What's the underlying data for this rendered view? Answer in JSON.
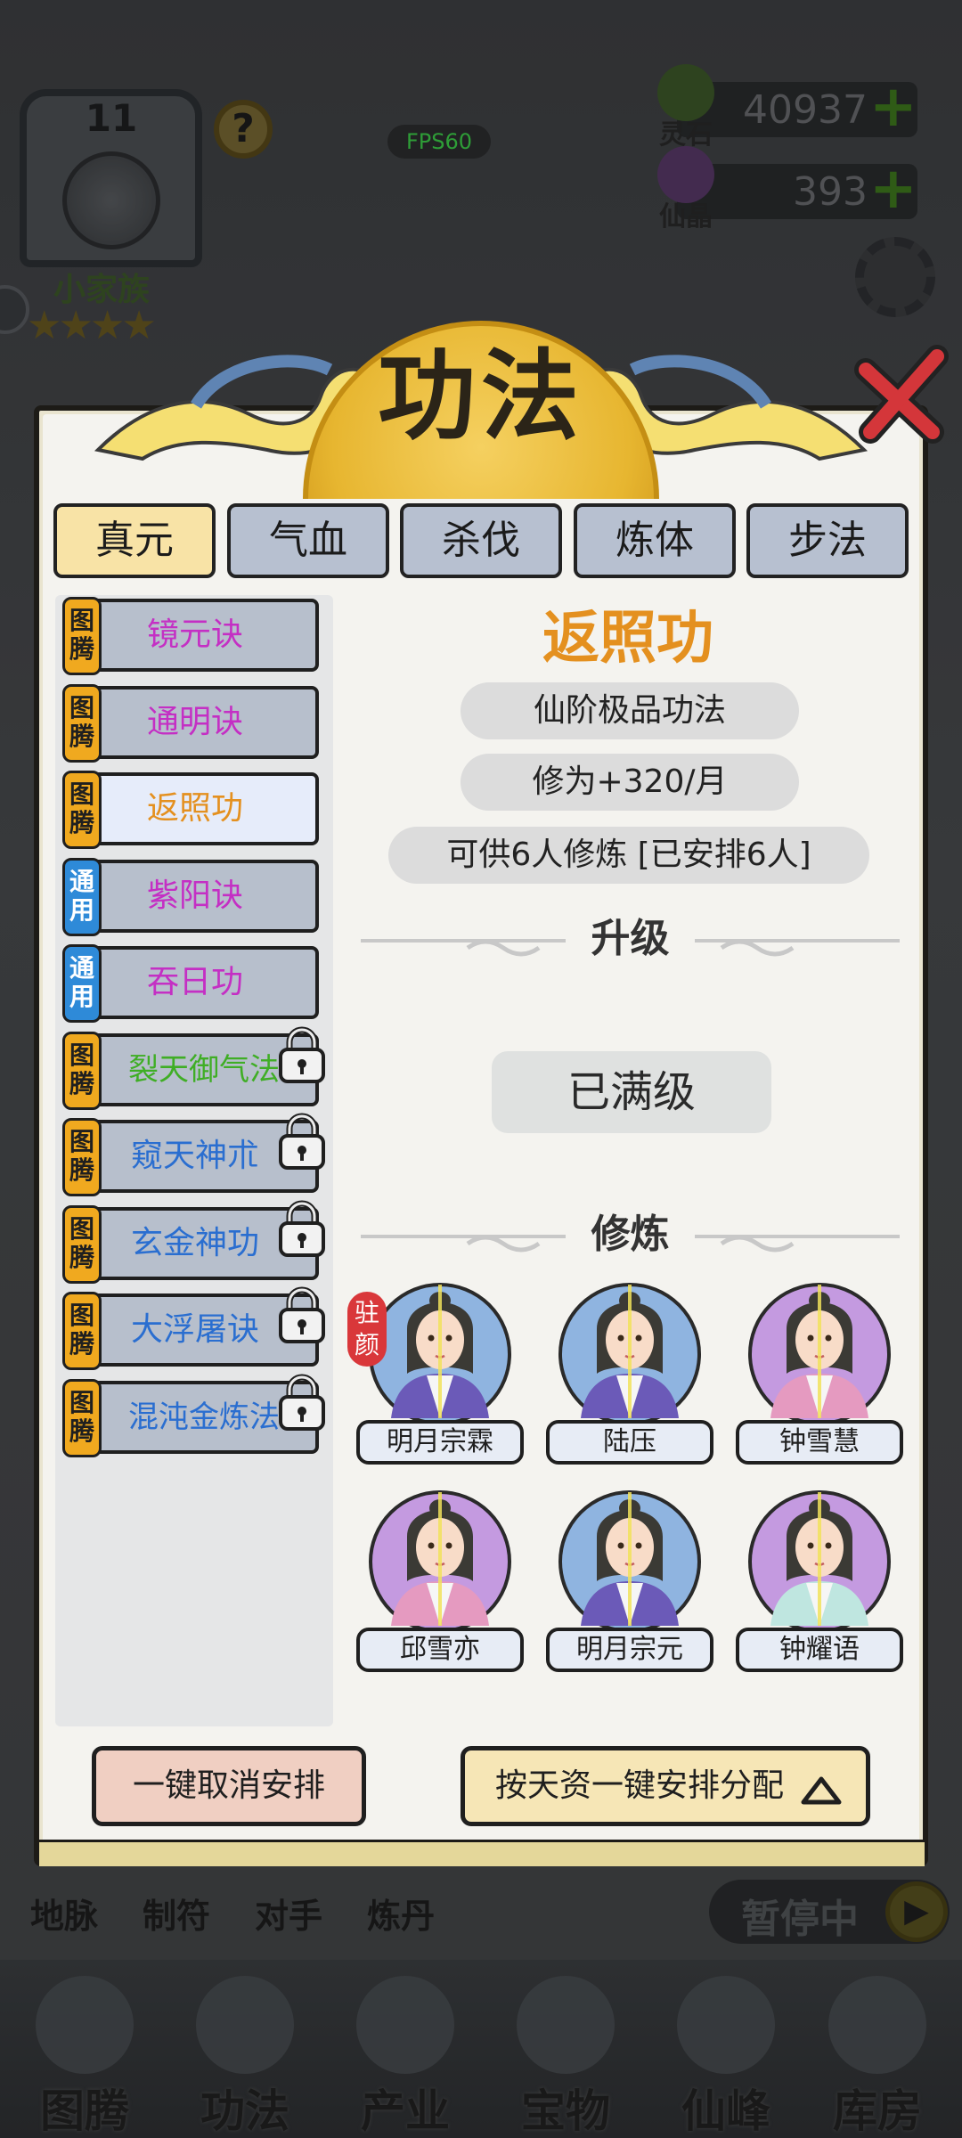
{
  "fps": "FPS60",
  "top": {
    "rank_number": "11",
    "help_symbol": "?",
    "clan_name": "小家族",
    "stars": "★★★★",
    "resources": [
      {
        "label": "灵石",
        "value": "40937",
        "plus": "+"
      },
      {
        "label": "仙晶",
        "value": "393",
        "plus": "+"
      }
    ]
  },
  "dialog": {
    "title": "功法",
    "tabs": [
      {
        "label": "真元",
        "active": true
      },
      {
        "label": "气血",
        "active": false
      },
      {
        "label": "杀伐",
        "active": false
      },
      {
        "label": "炼体",
        "active": false
      },
      {
        "label": "步法",
        "active": false
      }
    ],
    "techniques": [
      {
        "badge": "图腾",
        "name": "镜元诀",
        "color": "#c42fc4",
        "locked": false,
        "selected": false
      },
      {
        "badge": "图腾",
        "name": "通明诀",
        "color": "#c42fc4",
        "locked": false,
        "selected": false
      },
      {
        "badge": "图腾",
        "name": "返照功",
        "color": "#e4901f",
        "locked": false,
        "selected": true
      },
      {
        "badge": "通用",
        "name": "紫阳诀",
        "color": "#c42fc4",
        "locked": false,
        "selected": false
      },
      {
        "badge": "通用",
        "name": "吞日功",
        "color": "#c42fc4",
        "locked": false,
        "selected": false
      },
      {
        "badge": "图腾",
        "name": "裂天御气法",
        "color": "#3fae25",
        "locked": true,
        "selected": false
      },
      {
        "badge": "图腾",
        "name": "窥天神朮",
        "color": "#2a6ed0",
        "locked": true,
        "selected": false
      },
      {
        "badge": "图腾",
        "name": "玄金神功",
        "color": "#2a6ed0",
        "locked": true,
        "selected": false
      },
      {
        "badge": "图腾",
        "name": "大浮屠诀",
        "color": "#2a6ed0",
        "locked": true,
        "selected": false
      },
      {
        "badge": "图腾",
        "name": "混沌金炼法",
        "color": "#2a6ed0",
        "locked": true,
        "selected": false
      }
    ],
    "detail": {
      "name": "返照功",
      "grade": "仙阶极品功法",
      "cultivation": "修为+320/月",
      "capacity": "可供6人修炼 [已安排6人]",
      "upgrade_heading": "升级",
      "max_level": "已满级",
      "train_heading": "修炼",
      "resident_tag": "驻颜",
      "cultivators": [
        {
          "name": "明月宗霖",
          "bg": "#8fb4e0",
          "robe": "#6b5ab8"
        },
        {
          "name": "陆压",
          "bg": "#8fb4e0",
          "robe": "#6b5ab8"
        },
        {
          "name": "钟雪慧",
          "bg": "#c49ae0",
          "robe": "#e59ac0"
        },
        {
          "name": "邱雪亦",
          "bg": "#c49ae0",
          "robe": "#e59ac0"
        },
        {
          "name": "明月宗元",
          "bg": "#8fb4e0",
          "robe": "#6b5ab8"
        },
        {
          "name": "钟耀语",
          "bg": "#c49ae0",
          "robe": "#bfe6e0"
        }
      ]
    },
    "buttons": {
      "cancel_all": "一键取消安排",
      "auto_assign": "按天资一键安排分配"
    }
  },
  "bottom": {
    "quick": [
      "地脉",
      "制符",
      "对手",
      "炼丹"
    ],
    "paused": "暂停中",
    "nav": [
      "图腾",
      "功法",
      "产业",
      "宝物",
      "仙峰",
      "库房"
    ]
  },
  "colors": {
    "accent_gold": "#e4901f",
    "tab_active": "#f8e3a6",
    "tab_idle": "#b7c0d0",
    "close_red": "#d4363a"
  }
}
